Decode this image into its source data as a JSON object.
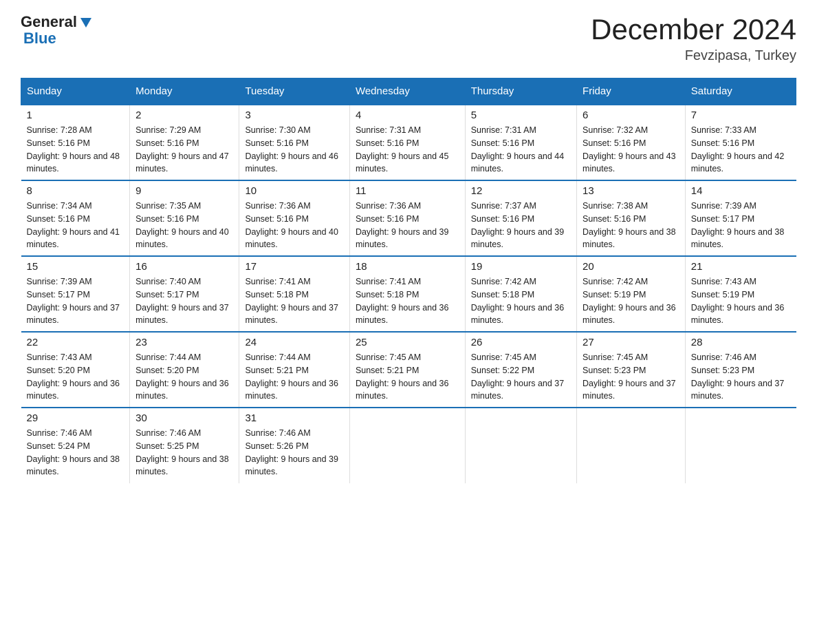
{
  "header": {
    "logo_general": "General",
    "logo_blue": "Blue",
    "month_title": "December 2024",
    "location": "Fevzipasa, Turkey"
  },
  "weekdays": [
    "Sunday",
    "Monday",
    "Tuesday",
    "Wednesday",
    "Thursday",
    "Friday",
    "Saturday"
  ],
  "weeks": [
    [
      {
        "day": "1",
        "sunrise": "7:28 AM",
        "sunset": "5:16 PM",
        "daylight": "9 hours and 48 minutes."
      },
      {
        "day": "2",
        "sunrise": "7:29 AM",
        "sunset": "5:16 PM",
        "daylight": "9 hours and 47 minutes."
      },
      {
        "day": "3",
        "sunrise": "7:30 AM",
        "sunset": "5:16 PM",
        "daylight": "9 hours and 46 minutes."
      },
      {
        "day": "4",
        "sunrise": "7:31 AM",
        "sunset": "5:16 PM",
        "daylight": "9 hours and 45 minutes."
      },
      {
        "day": "5",
        "sunrise": "7:31 AM",
        "sunset": "5:16 PM",
        "daylight": "9 hours and 44 minutes."
      },
      {
        "day": "6",
        "sunrise": "7:32 AM",
        "sunset": "5:16 PM",
        "daylight": "9 hours and 43 minutes."
      },
      {
        "day": "7",
        "sunrise": "7:33 AM",
        "sunset": "5:16 PM",
        "daylight": "9 hours and 42 minutes."
      }
    ],
    [
      {
        "day": "8",
        "sunrise": "7:34 AM",
        "sunset": "5:16 PM",
        "daylight": "9 hours and 41 minutes."
      },
      {
        "day": "9",
        "sunrise": "7:35 AM",
        "sunset": "5:16 PM",
        "daylight": "9 hours and 40 minutes."
      },
      {
        "day": "10",
        "sunrise": "7:36 AM",
        "sunset": "5:16 PM",
        "daylight": "9 hours and 40 minutes."
      },
      {
        "day": "11",
        "sunrise": "7:36 AM",
        "sunset": "5:16 PM",
        "daylight": "9 hours and 39 minutes."
      },
      {
        "day": "12",
        "sunrise": "7:37 AM",
        "sunset": "5:16 PM",
        "daylight": "9 hours and 39 minutes."
      },
      {
        "day": "13",
        "sunrise": "7:38 AM",
        "sunset": "5:16 PM",
        "daylight": "9 hours and 38 minutes."
      },
      {
        "day": "14",
        "sunrise": "7:39 AM",
        "sunset": "5:17 PM",
        "daylight": "9 hours and 38 minutes."
      }
    ],
    [
      {
        "day": "15",
        "sunrise": "7:39 AM",
        "sunset": "5:17 PM",
        "daylight": "9 hours and 37 minutes."
      },
      {
        "day": "16",
        "sunrise": "7:40 AM",
        "sunset": "5:17 PM",
        "daylight": "9 hours and 37 minutes."
      },
      {
        "day": "17",
        "sunrise": "7:41 AM",
        "sunset": "5:18 PM",
        "daylight": "9 hours and 37 minutes."
      },
      {
        "day": "18",
        "sunrise": "7:41 AM",
        "sunset": "5:18 PM",
        "daylight": "9 hours and 36 minutes."
      },
      {
        "day": "19",
        "sunrise": "7:42 AM",
        "sunset": "5:18 PM",
        "daylight": "9 hours and 36 minutes."
      },
      {
        "day": "20",
        "sunrise": "7:42 AM",
        "sunset": "5:19 PM",
        "daylight": "9 hours and 36 minutes."
      },
      {
        "day": "21",
        "sunrise": "7:43 AM",
        "sunset": "5:19 PM",
        "daylight": "9 hours and 36 minutes."
      }
    ],
    [
      {
        "day": "22",
        "sunrise": "7:43 AM",
        "sunset": "5:20 PM",
        "daylight": "9 hours and 36 minutes."
      },
      {
        "day": "23",
        "sunrise": "7:44 AM",
        "sunset": "5:20 PM",
        "daylight": "9 hours and 36 minutes."
      },
      {
        "day": "24",
        "sunrise": "7:44 AM",
        "sunset": "5:21 PM",
        "daylight": "9 hours and 36 minutes."
      },
      {
        "day": "25",
        "sunrise": "7:45 AM",
        "sunset": "5:21 PM",
        "daylight": "9 hours and 36 minutes."
      },
      {
        "day": "26",
        "sunrise": "7:45 AM",
        "sunset": "5:22 PM",
        "daylight": "9 hours and 37 minutes."
      },
      {
        "day": "27",
        "sunrise": "7:45 AM",
        "sunset": "5:23 PM",
        "daylight": "9 hours and 37 minutes."
      },
      {
        "day": "28",
        "sunrise": "7:46 AM",
        "sunset": "5:23 PM",
        "daylight": "9 hours and 37 minutes."
      }
    ],
    [
      {
        "day": "29",
        "sunrise": "7:46 AM",
        "sunset": "5:24 PM",
        "daylight": "9 hours and 38 minutes."
      },
      {
        "day": "30",
        "sunrise": "7:46 AM",
        "sunset": "5:25 PM",
        "daylight": "9 hours and 38 minutes."
      },
      {
        "day": "31",
        "sunrise": "7:46 AM",
        "sunset": "5:26 PM",
        "daylight": "9 hours and 39 minutes."
      },
      null,
      null,
      null,
      null
    ]
  ]
}
